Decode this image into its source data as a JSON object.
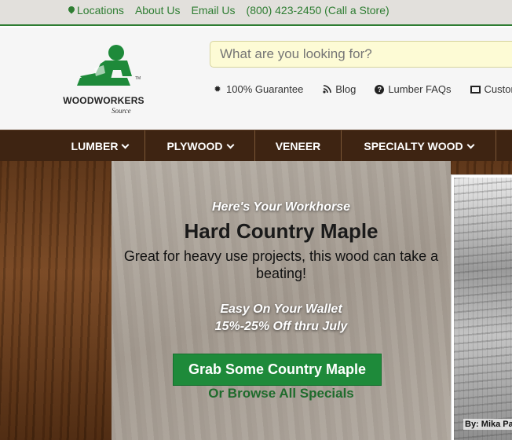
{
  "topbar": {
    "locations": "Locations",
    "about": "About Us",
    "email": "Email Us",
    "phone": "(800) 423-2450 (Call a Store)"
  },
  "logo": {
    "name": "WOODWORKERS",
    "sub": "Source"
  },
  "search": {
    "placeholder": "What are you looking for?"
  },
  "features": {
    "guarantee": "100% Guarantee",
    "blog": "Blog",
    "faqs": "Lumber FAQs",
    "customer": "Customer"
  },
  "nav": {
    "items": [
      {
        "label": "LUMBER"
      },
      {
        "label": "PLYWOOD"
      },
      {
        "label": "VENEER"
      },
      {
        "label": "SPECIALTY WOOD"
      }
    ]
  },
  "hero": {
    "kicker": "Here's Your Workhorse",
    "title": "Hard Country Maple",
    "description": "Great for heavy use projects, this wood can take a beating!",
    "wallet_line1": "Easy On Your Wallet",
    "wallet_line2": "15%-25% Off thru July",
    "cta": "Grab Some Country Maple",
    "browse": "Or Browse All Specials",
    "photo_caption": "By: Mika Pa"
  },
  "colors": {
    "brand_green": "#2e7d32",
    "nav_brown": "#3e2412",
    "cta_green": "#1e8a3a"
  }
}
